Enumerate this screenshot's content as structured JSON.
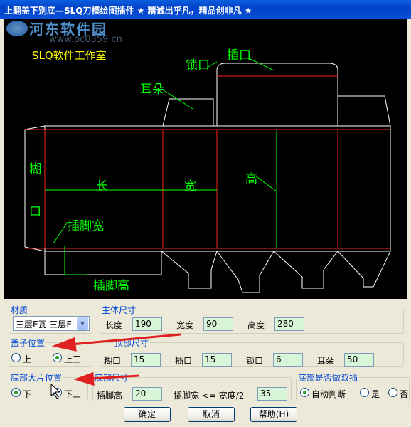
{
  "title": "上翻盖下别底—SLQ刀模绘图插件    ★ 精诚出乎凡，精品创非凡 ★",
  "watermark": {
    "site": "河东软件园",
    "url": "www.pc0359.cn"
  },
  "drawing": {
    "studio": "SLQ软件工作室",
    "labels": {
      "insert_flap": "插口",
      "lock": "锁口",
      "ear": "耳朵",
      "glue_top": "糊",
      "glue_bottom": "口",
      "length": "长",
      "width": "宽",
      "height": "高",
      "foot_width": "插脚宽",
      "foot_height": "插脚高"
    }
  },
  "material": {
    "legend": "材质",
    "value": "三层E瓦 三层E"
  },
  "main_size": {
    "legend": "主体尺寸",
    "length_label": "长度",
    "length": "190",
    "width_label": "宽度",
    "width": "90",
    "height_label": "高度",
    "height": "280"
  },
  "lid_position": {
    "legend": "盖子位置",
    "opt1": "上一",
    "opt2": "上三"
  },
  "top_size": {
    "legend": "顶部尺寸",
    "glue_label": "糊口",
    "glue": "15",
    "insert_label": "插口",
    "insert": "15",
    "lock_label": "锁口",
    "lock": "6",
    "ear_label": "耳朵",
    "ear": "50"
  },
  "bottom_position": {
    "legend": "底部大片位置",
    "opt1": "下一",
    "opt2": "下三"
  },
  "bottom_size": {
    "legend": "底部尺寸",
    "foot_h_label": "插脚高",
    "foot_h": "20",
    "foot_w_label": "插脚宽  <= 宽度/2",
    "foot_w": "35"
  },
  "double_insert": {
    "legend": "底部是否做双插",
    "opt1": "自动判断",
    "opt2": "是",
    "opt3": "否"
  },
  "buttons": {
    "ok": "确定",
    "cancel": "取消",
    "help": "帮助(H)"
  }
}
